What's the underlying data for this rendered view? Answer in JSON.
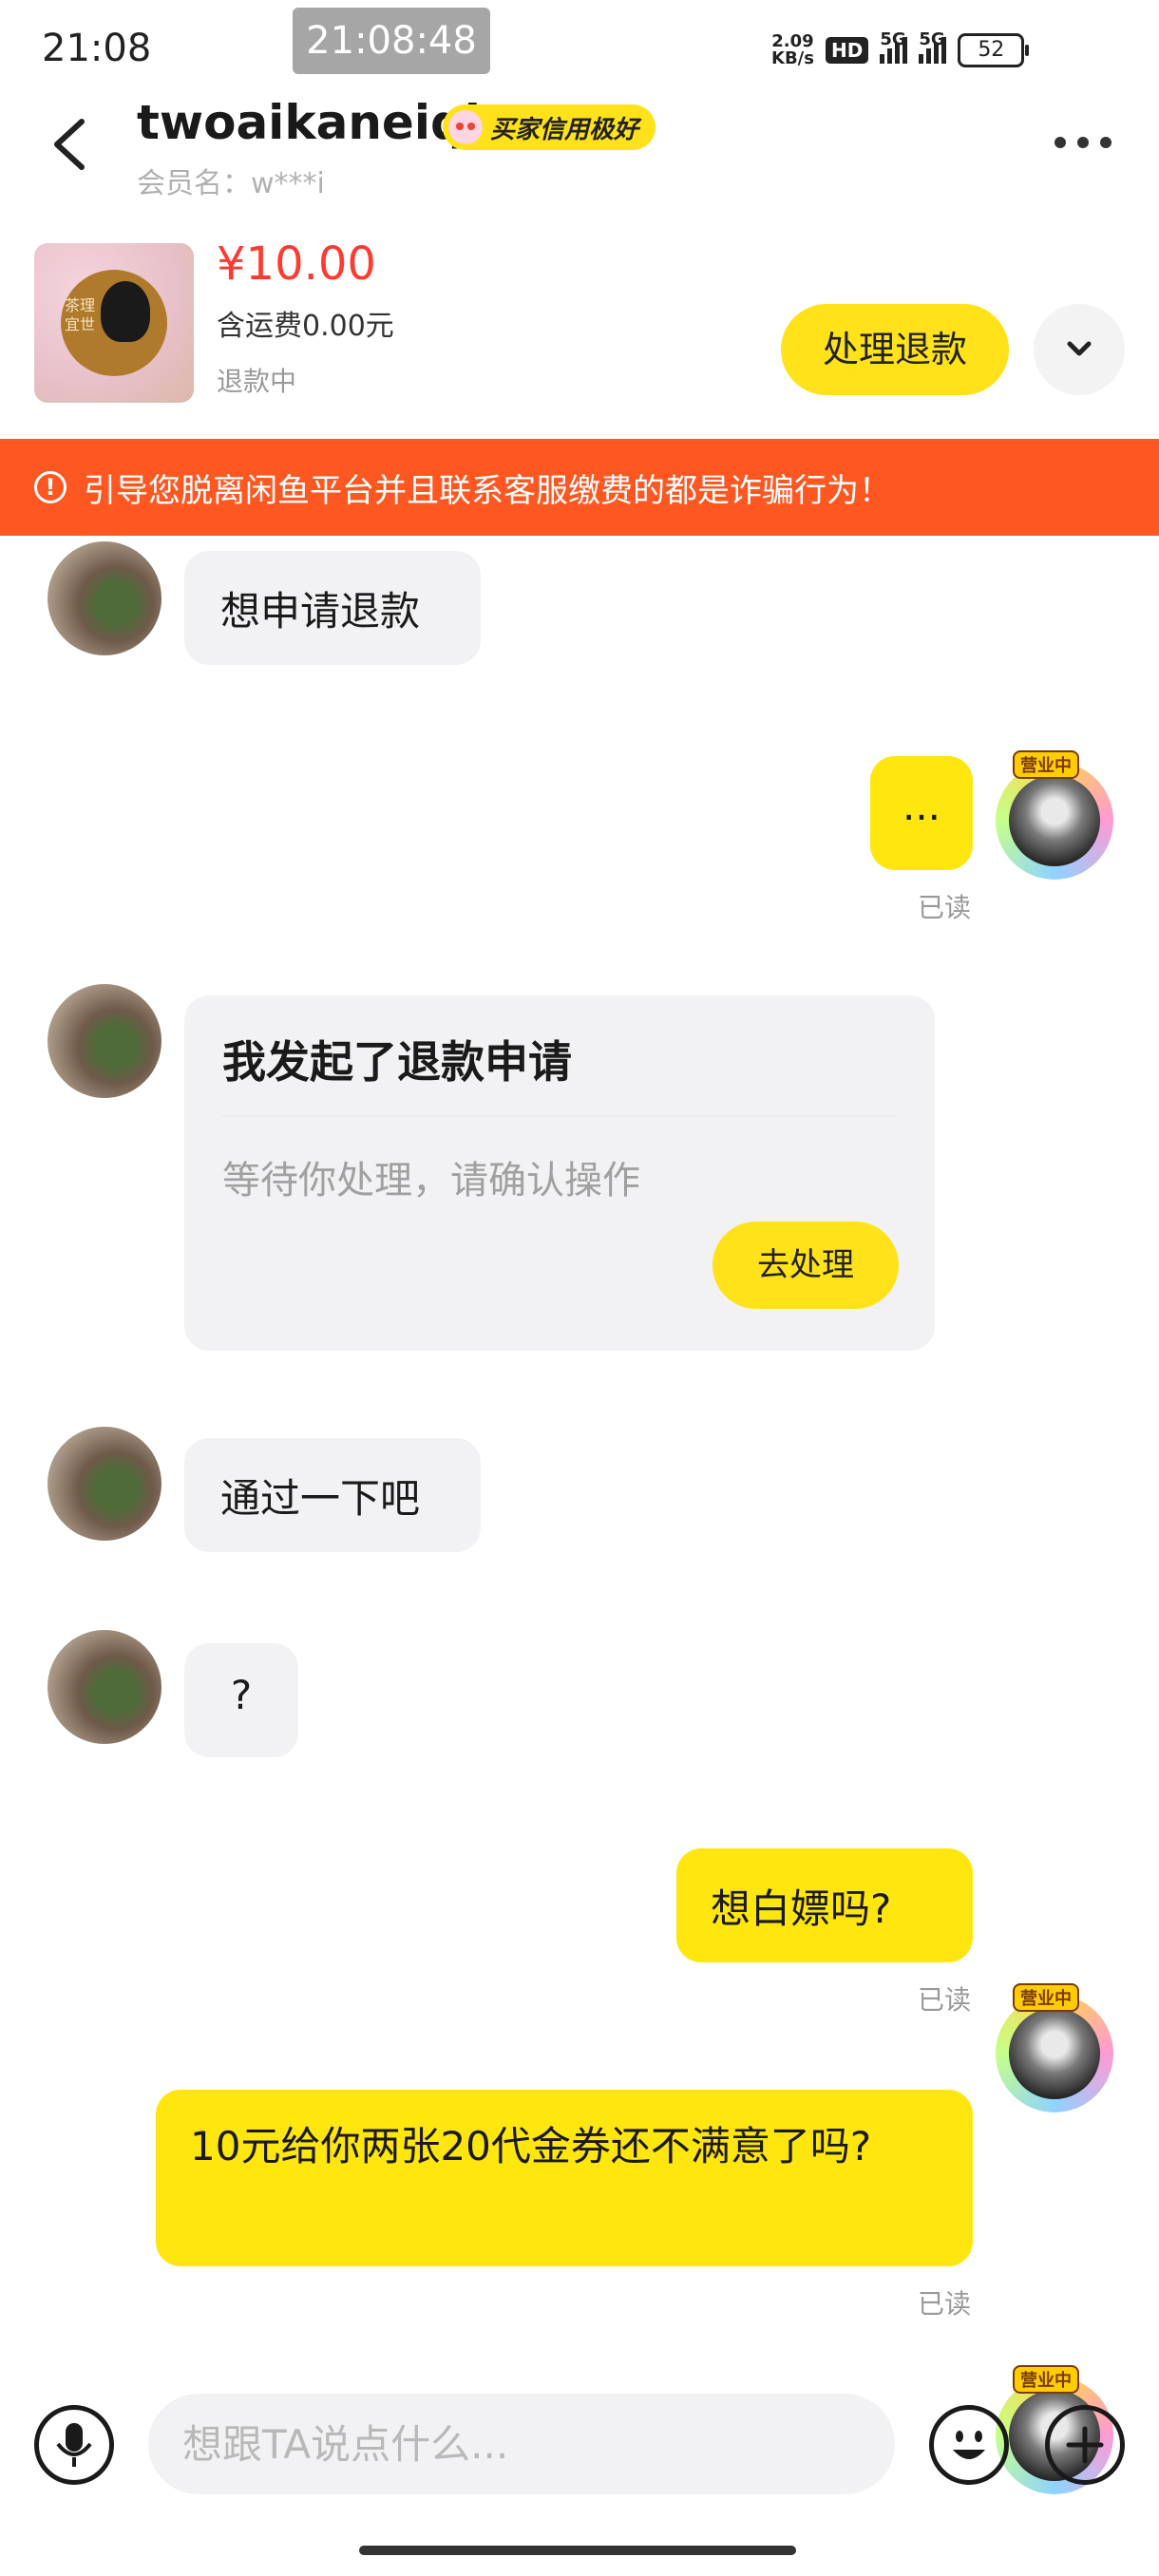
{
  "status_bar": {
    "time": "21:08",
    "clock_overlay": "21:08:48",
    "net_speed_value": "2.09",
    "net_speed_unit": "KB/s",
    "hd": "HD",
    "network_1": "5G",
    "network_2": "5G",
    "battery": "52"
  },
  "header": {
    "nickname": "twoaikaneiqi",
    "credit_badge": "买家信用极好",
    "member_name": "会员名：w***i"
  },
  "product": {
    "price": "¥10.00",
    "shipping": "含运费0.00元",
    "status": "退款中",
    "thumb_text": "茶理宜世",
    "refund_button": "处理退款"
  },
  "warning": {
    "text": "引导您脱离闲鱼平台并且联系客服缴费的都是诈骗行为！"
  },
  "messages": [
    {
      "sender": "other",
      "text": "想申请退款"
    },
    {
      "sender": "self",
      "text": "...",
      "read": "已读"
    },
    {
      "sender": "other",
      "type": "refund_card",
      "title": "我发起了退款申请",
      "subtitle": "等待你处理，请确认操作",
      "button": "去处理"
    },
    {
      "sender": "other",
      "text": "通过一下吧"
    },
    {
      "sender": "other",
      "text": "?"
    },
    {
      "sender": "self",
      "text": "想白嫖吗?",
      "read": "已读"
    },
    {
      "sender": "self",
      "text": "10元给你两张20代金券还不满意了吗?",
      "read": "已读"
    }
  ],
  "self_avatar_tag": "营业中",
  "input": {
    "placeholder": "想跟TA说点什么..."
  }
}
